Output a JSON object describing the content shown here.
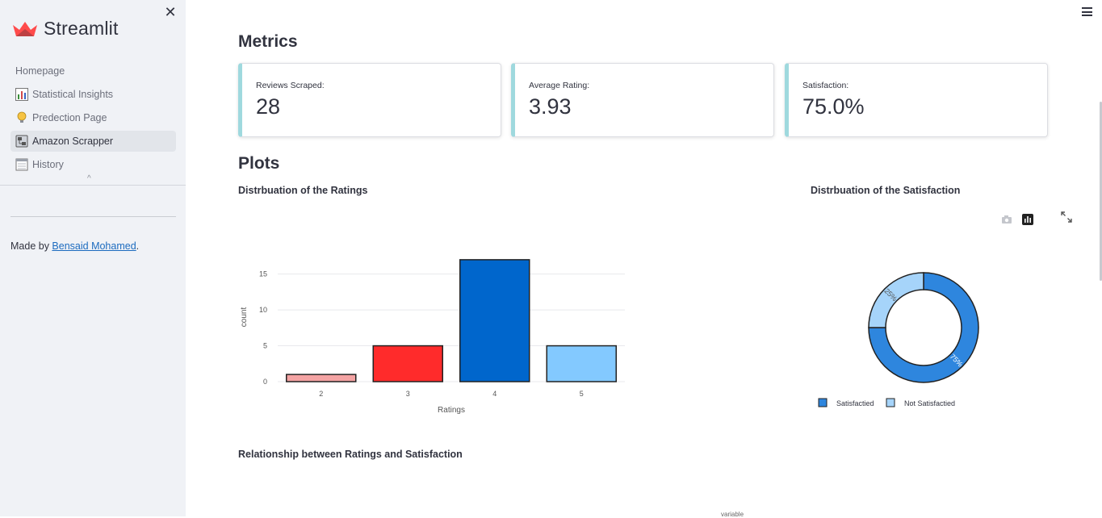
{
  "sidebar": {
    "brand": "Streamlit",
    "nav": [
      {
        "label": "Homepage",
        "icon": "",
        "active": false
      },
      {
        "label": "Statistical Insights",
        "icon": "bar-chart-icon",
        "active": false
      },
      {
        "label": "Predection Page",
        "icon": "lightbulb-icon",
        "active": false
      },
      {
        "label": "Amazon Scrapper",
        "icon": "scraper-icon",
        "active": true
      },
      {
        "label": "History",
        "icon": "calendar-icon",
        "active": false
      }
    ],
    "made_by_prefix": "Made by ",
    "made_by_author": "Bensaid Mohamed",
    "made_by_suffix": "."
  },
  "main": {
    "metrics_title": "Metrics",
    "metrics": [
      {
        "label": "Reviews Scraped:",
        "value": "28"
      },
      {
        "label": "Average Rating:",
        "value": "3.93"
      },
      {
        "label": "Satisfaction:",
        "value": "75.0%"
      }
    ],
    "plots_title": "Plots",
    "ratings_plot_title": "Distrbuation of the Ratings",
    "satisfaction_plot_title": "Distrbuation of the Satisfaction",
    "relationship_title": "Relationship between Ratings and Satisfaction",
    "relationship_partial_label": "variable"
  },
  "chart_data": [
    {
      "type": "bar",
      "categories": [
        "2",
        "3",
        "4",
        "5"
      ],
      "values": [
        1,
        5,
        17,
        5
      ],
      "colors": [
        "#f4a3a3",
        "#ff2b2b",
        "#0066cc",
        "#83c9ff"
      ],
      "xlabel": "Ratings",
      "ylabel": "count",
      "yticks": [
        0,
        5,
        10,
        15
      ],
      "ylim": [
        0,
        18
      ],
      "grid": true
    },
    {
      "type": "pie",
      "donut": true,
      "labels": [
        "Satisfactied",
        "Not Satisfactied"
      ],
      "values": [
        75,
        25
      ],
      "slice_labels": [
        "75%",
        "25%"
      ],
      "colors": [
        "#2e86de",
        "#a6d4fa"
      ],
      "legend": "bottom"
    }
  ]
}
